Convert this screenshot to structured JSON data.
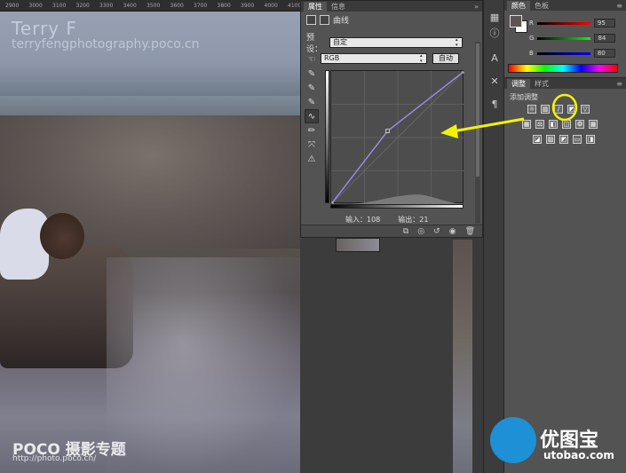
{
  "ruler": {
    "ticks": [
      "2900",
      "3000",
      "3100",
      "3200",
      "3300",
      "3400",
      "3500",
      "3600",
      "3700",
      "3800",
      "3900",
      "4000",
      "4100"
    ]
  },
  "canvas": {
    "watermark_name": "Terry  F",
    "watermark_site": "terryfengphotography.poco.cn",
    "poco_logo": "POCO 摄影专题",
    "poco_url": "http://photo.poco.cn/"
  },
  "properties": {
    "tabs": [
      "属性",
      "信息"
    ],
    "title": "曲线",
    "preset_label": "预设：",
    "preset_value": "自定",
    "channel_value": "RGB",
    "auto_button": "自动",
    "input_label": "输入：108",
    "output_label": "输出：21",
    "curve_points": [
      [
        0,
        0
      ],
      [
        108,
        140
      ],
      [
        255,
        255
      ]
    ]
  },
  "color_panel": {
    "tabs": [
      "颜色",
      "色板"
    ],
    "sliders": [
      {
        "label": "R",
        "value": "95",
        "color": "#ff4040"
      },
      {
        "label": "G",
        "value": "84",
        "color": "#40c040"
      },
      {
        "label": "B",
        "value": "80",
        "color": "#4060ff"
      }
    ]
  },
  "adjust_panel": {
    "tabs": [
      "调整",
      "样式"
    ],
    "add_label": "添加调整"
  },
  "logo": {
    "name": "优图宝",
    "url": "utobao.com"
  },
  "colors": {
    "annotation": "#f2f200",
    "accent": "#1e90d6"
  }
}
